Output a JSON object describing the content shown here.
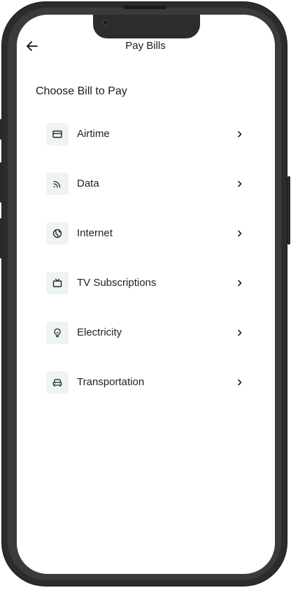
{
  "header": {
    "title": "Pay Bills",
    "back_icon": "arrow-left-icon"
  },
  "section": {
    "title": "Choose Bill to Pay"
  },
  "bills": [
    {
      "label": "Airtime",
      "icon": "card-icon"
    },
    {
      "label": "Data",
      "icon": "rss-icon"
    },
    {
      "label": "Internet",
      "icon": "globe-icon"
    },
    {
      "label": "TV Subscriptions",
      "icon": "tv-icon"
    },
    {
      "label": "Electricity",
      "icon": "bulb-icon"
    },
    {
      "label": "Transportation",
      "icon": "car-icon"
    }
  ],
  "colors": {
    "icon_bg": "#eef5f1",
    "icon_stroke": "#1f2a33",
    "frame": "#2c2c2c",
    "text": "#1a1a1a"
  }
}
